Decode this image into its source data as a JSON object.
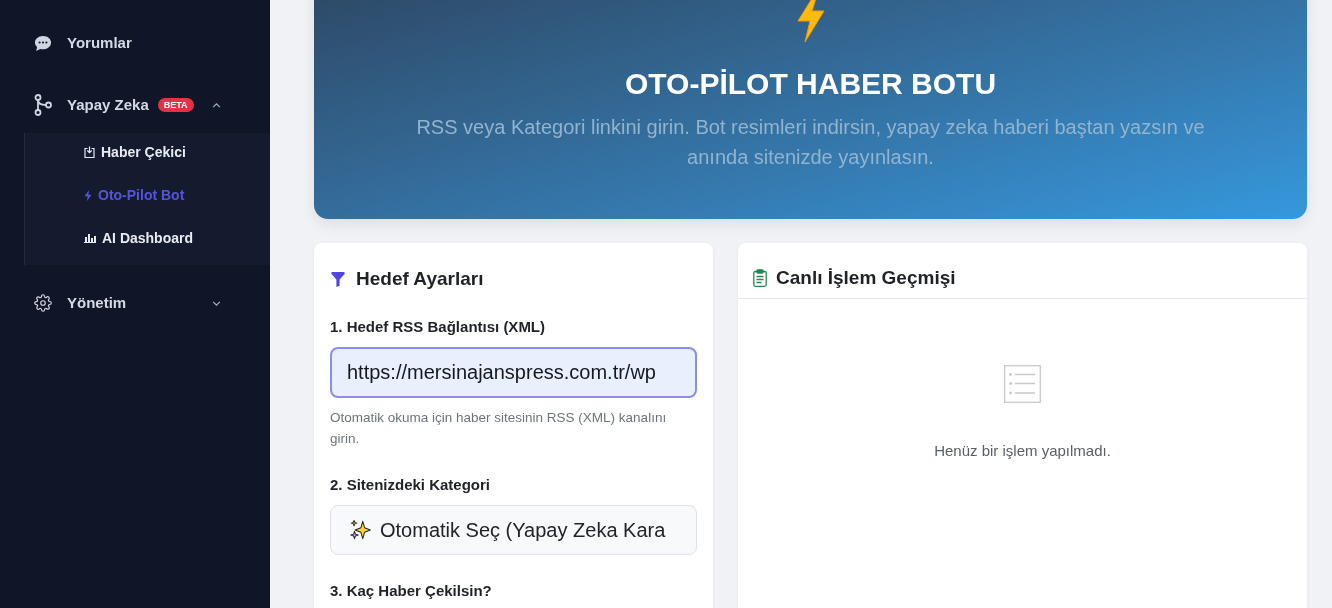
{
  "sidebar": {
    "items": [
      {
        "label": "Yorumlar"
      },
      {
        "label": "Yapay Zeka",
        "badge": "BETA",
        "expanded": true,
        "children": [
          {
            "label": "Haber Çekici",
            "selected": false
          },
          {
            "label": "Oto-Pilot Bot",
            "selected": true
          },
          {
            "label": "AI Dashboard",
            "selected": false
          }
        ]
      },
      {
        "label": "Yönetim",
        "expanded": false
      }
    ]
  },
  "hero": {
    "title": "OTO-PİLOT HABER BOTU",
    "subtitle": "RSS veya Kategori linkini girin. Bot resimleri indirsin, yapay zeka haberi baştan yazsın ve anında sitenizde yayınlasın."
  },
  "settings_panel": {
    "title": "Hedef Ayarları",
    "fields": [
      {
        "label": "1. Hedef RSS Bağlantısı (XML)",
        "control": {
          "kind": "text",
          "value": "https://mersinajanspress.com.tr/wp",
          "focused": true
        },
        "help": "Otomatik okuma için haber sitesinin RSS (XML) kanalını girin."
      },
      {
        "label": "2. Sitenizdeki Kategori",
        "control": {
          "kind": "select",
          "value": "Otomatik Seç (Yapay Zeka Kara"
        }
      },
      {
        "label": "3. Kaç Haber Çekilsin?"
      }
    ]
  },
  "log_panel": {
    "title": "Canlı İşlem Geçmişi",
    "empty_message": "Henüz bir işlem yapılmadı."
  }
}
